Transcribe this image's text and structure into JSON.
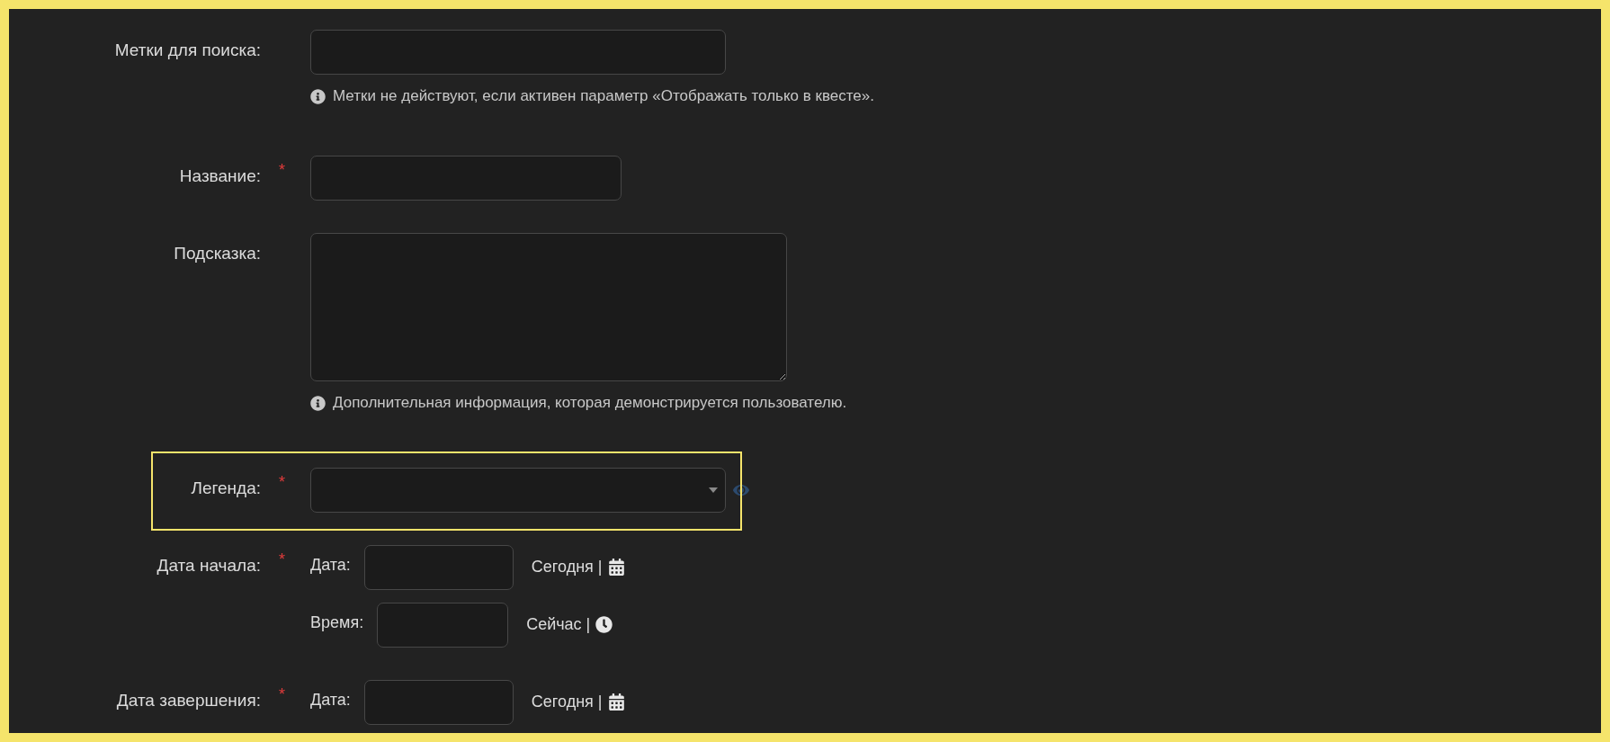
{
  "fields": [
    {
      "kind": "text",
      "label": "Метки для поиска:",
      "hint": "Метки не действуют, если активен параметр «Отображать только в квесте».",
      "highlighted": false
    },
    {
      "kind": "short_text",
      "label": "Название:",
      "required_mark": "*",
      "highlighted": false
    },
    {
      "kind": "textarea",
      "label": "Подсказка:",
      "hint": "Дополнительная информация, которая демонстрируется пользователю.",
      "highlighted": false
    },
    {
      "kind": "select",
      "label": "Легенда:",
      "required_mark": "*",
      "highlighted": true
    },
    {
      "kind": "datetime",
      "label": "Дата начала:",
      "required_mark": "*",
      "highlighted": false,
      "parts": [
        {
          "kind": "date",
          "label": "Дата:",
          "shortcut": "Сегодня |"
        },
        {
          "kind": "time",
          "label": "Время:",
          "shortcut": "Сейчас |"
        }
      ]
    },
    {
      "kind": "datetime",
      "label": "Дата завершения:",
      "required_mark": "*",
      "highlighted": false,
      "parts": [
        {
          "kind": "date",
          "label": "Дата:",
          "shortcut": "Сегодня |"
        }
      ]
    }
  ]
}
